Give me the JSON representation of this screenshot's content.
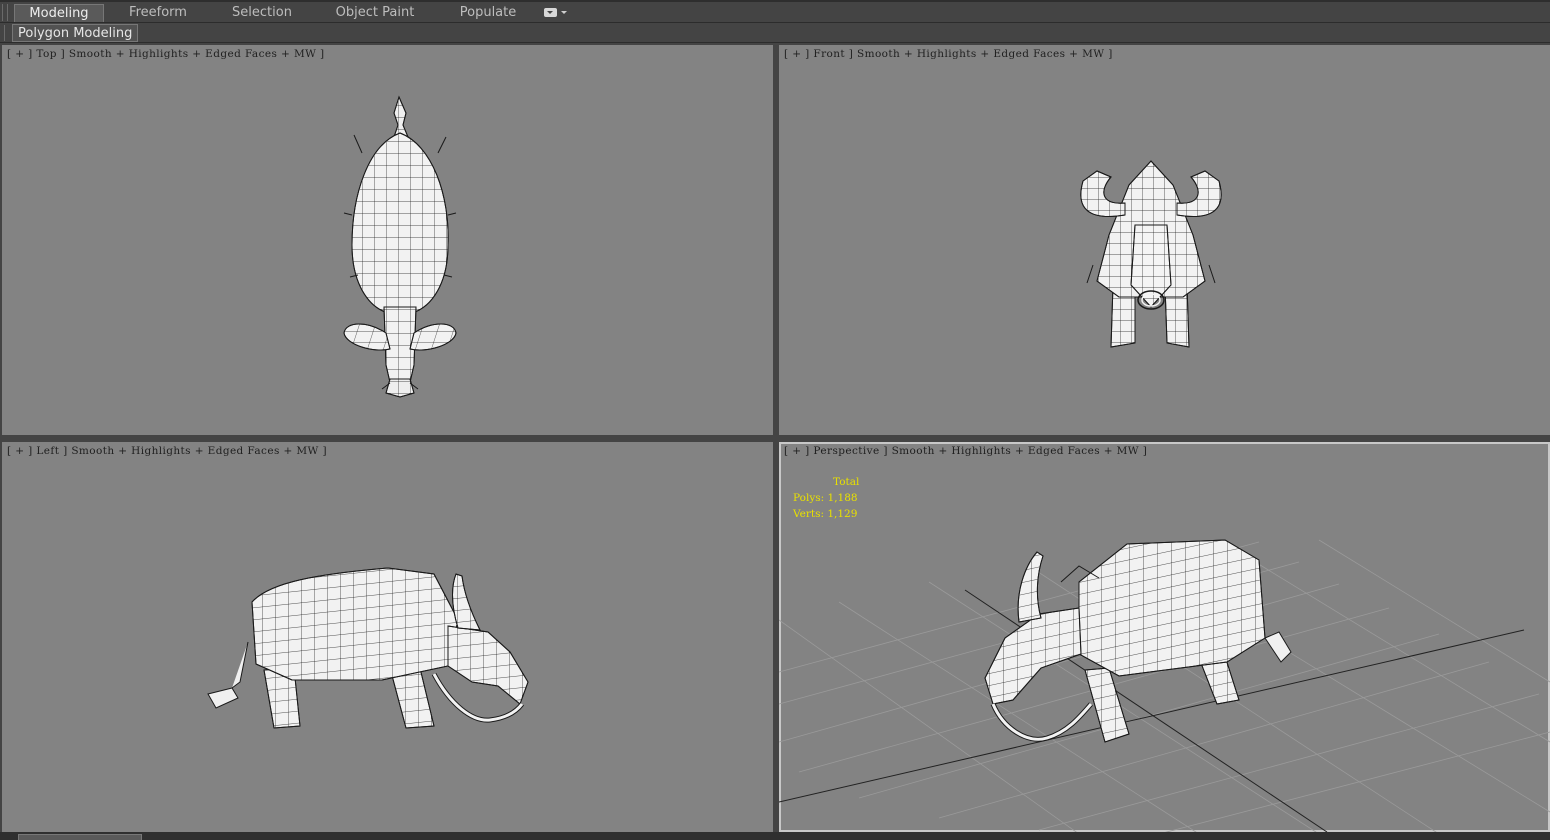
{
  "ribbon": {
    "tabs": [
      {
        "label": "Modeling",
        "active": true
      },
      {
        "label": "Freeform",
        "active": false
      },
      {
        "label": "Selection",
        "active": false
      },
      {
        "label": "Object Paint",
        "active": false
      },
      {
        "label": "Populate",
        "active": false
      }
    ],
    "overflow_icon": "dropdown-box-icon"
  },
  "panel": {
    "label": "Polygon Modeling"
  },
  "viewports": {
    "top": {
      "menu": "[ + ]",
      "view": "Top",
      "shading": "Smooth + Highlights + Edged Faces + MW ]"
    },
    "front": {
      "menu": "[ + ]",
      "view": "Front",
      "shading": "Smooth + Highlights + Edged Faces + MW ]"
    },
    "left": {
      "menu": "[ + ]",
      "view": "Left",
      "shading": "Smooth + Highlights + Edged Faces + MW ]"
    },
    "perspective": {
      "menu": "[ + ]",
      "view": "Perspective",
      "shading": "Smooth + Highlights + Edged Faces + MW ]",
      "stats": {
        "title": "Total",
        "polys": "Polys: 1,188",
        "verts": "Verts: 1,129"
      }
    }
  },
  "colors": {
    "viewport_bg": "#838383",
    "stats_text": "#e8e000",
    "mesh_fill": "#f2f2f2",
    "wire": "#1a1a1a"
  }
}
